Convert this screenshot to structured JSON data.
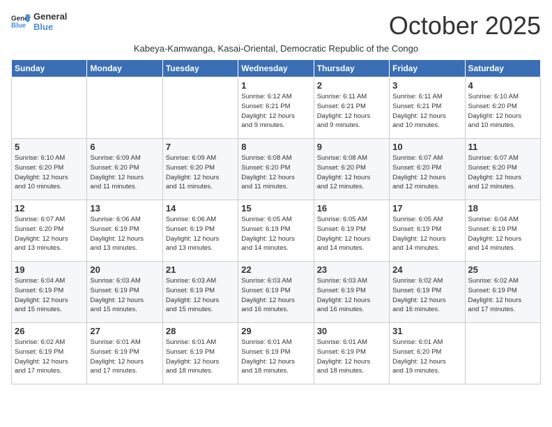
{
  "header": {
    "logo_line1": "General",
    "logo_line2": "Blue",
    "month_title": "October 2025",
    "subtitle": "Kabeya-Kamwanga, Kasai-Oriental, Democratic Republic of the Congo"
  },
  "days_of_week": [
    "Sunday",
    "Monday",
    "Tuesday",
    "Wednesday",
    "Thursday",
    "Friday",
    "Saturday"
  ],
  "weeks": [
    [
      {
        "day": "",
        "info": ""
      },
      {
        "day": "",
        "info": ""
      },
      {
        "day": "",
        "info": ""
      },
      {
        "day": "1",
        "info": "Sunrise: 6:12 AM\nSunset: 6:21 PM\nDaylight: 12 hours\nand 9 minutes."
      },
      {
        "day": "2",
        "info": "Sunrise: 6:11 AM\nSunset: 6:21 PM\nDaylight: 12 hours\nand 9 minutes."
      },
      {
        "day": "3",
        "info": "Sunrise: 6:11 AM\nSunset: 6:21 PM\nDaylight: 12 hours\nand 10 minutes."
      },
      {
        "day": "4",
        "info": "Sunrise: 6:10 AM\nSunset: 6:20 PM\nDaylight: 12 hours\nand 10 minutes."
      }
    ],
    [
      {
        "day": "5",
        "info": "Sunrise: 6:10 AM\nSunset: 6:20 PM\nDaylight: 12 hours\nand 10 minutes."
      },
      {
        "day": "6",
        "info": "Sunrise: 6:09 AM\nSunset: 6:20 PM\nDaylight: 12 hours\nand 11 minutes."
      },
      {
        "day": "7",
        "info": "Sunrise: 6:09 AM\nSunset: 6:20 PM\nDaylight: 12 hours\nand 11 minutes."
      },
      {
        "day": "8",
        "info": "Sunrise: 6:08 AM\nSunset: 6:20 PM\nDaylight: 12 hours\nand 11 minutes."
      },
      {
        "day": "9",
        "info": "Sunrise: 6:08 AM\nSunset: 6:20 PM\nDaylight: 12 hours\nand 12 minutes."
      },
      {
        "day": "10",
        "info": "Sunrise: 6:07 AM\nSunset: 6:20 PM\nDaylight: 12 hours\nand 12 minutes."
      },
      {
        "day": "11",
        "info": "Sunrise: 6:07 AM\nSunset: 6:20 PM\nDaylight: 12 hours\nand 12 minutes."
      }
    ],
    [
      {
        "day": "12",
        "info": "Sunrise: 6:07 AM\nSunset: 6:20 PM\nDaylight: 12 hours\nand 13 minutes."
      },
      {
        "day": "13",
        "info": "Sunrise: 6:06 AM\nSunset: 6:19 PM\nDaylight: 12 hours\nand 13 minutes."
      },
      {
        "day": "14",
        "info": "Sunrise: 6:06 AM\nSunset: 6:19 PM\nDaylight: 12 hours\nand 13 minutes."
      },
      {
        "day": "15",
        "info": "Sunrise: 6:05 AM\nSunset: 6:19 PM\nDaylight: 12 hours\nand 14 minutes."
      },
      {
        "day": "16",
        "info": "Sunrise: 6:05 AM\nSunset: 6:19 PM\nDaylight: 12 hours\nand 14 minutes."
      },
      {
        "day": "17",
        "info": "Sunrise: 6:05 AM\nSunset: 6:19 PM\nDaylight: 12 hours\nand 14 minutes."
      },
      {
        "day": "18",
        "info": "Sunrise: 6:04 AM\nSunset: 6:19 PM\nDaylight: 12 hours\nand 14 minutes."
      }
    ],
    [
      {
        "day": "19",
        "info": "Sunrise: 6:04 AM\nSunset: 6:19 PM\nDaylight: 12 hours\nand 15 minutes."
      },
      {
        "day": "20",
        "info": "Sunrise: 6:03 AM\nSunset: 6:19 PM\nDaylight: 12 hours\nand 15 minutes."
      },
      {
        "day": "21",
        "info": "Sunrise: 6:03 AM\nSunset: 6:19 PM\nDaylight: 12 hours\nand 15 minutes."
      },
      {
        "day": "22",
        "info": "Sunrise: 6:03 AM\nSunset: 6:19 PM\nDaylight: 12 hours\nand 16 minutes."
      },
      {
        "day": "23",
        "info": "Sunrise: 6:03 AM\nSunset: 6:19 PM\nDaylight: 12 hours\nand 16 minutes."
      },
      {
        "day": "24",
        "info": "Sunrise: 6:02 AM\nSunset: 6:19 PM\nDaylight: 12 hours\nand 16 minutes."
      },
      {
        "day": "25",
        "info": "Sunrise: 6:02 AM\nSunset: 6:19 PM\nDaylight: 12 hours\nand 17 minutes."
      }
    ],
    [
      {
        "day": "26",
        "info": "Sunrise: 6:02 AM\nSunset: 6:19 PM\nDaylight: 12 hours\nand 17 minutes."
      },
      {
        "day": "27",
        "info": "Sunrise: 6:01 AM\nSunset: 6:19 PM\nDaylight: 12 hours\nand 17 minutes."
      },
      {
        "day": "28",
        "info": "Sunrise: 6:01 AM\nSunset: 6:19 PM\nDaylight: 12 hours\nand 18 minutes."
      },
      {
        "day": "29",
        "info": "Sunrise: 6:01 AM\nSunset: 6:19 PM\nDaylight: 12 hours\nand 18 minutes."
      },
      {
        "day": "30",
        "info": "Sunrise: 6:01 AM\nSunset: 6:19 PM\nDaylight: 12 hours\nand 18 minutes."
      },
      {
        "day": "31",
        "info": "Sunrise: 6:01 AM\nSunset: 6:20 PM\nDaylight: 12 hours\nand 19 minutes."
      },
      {
        "day": "",
        "info": ""
      }
    ]
  ]
}
